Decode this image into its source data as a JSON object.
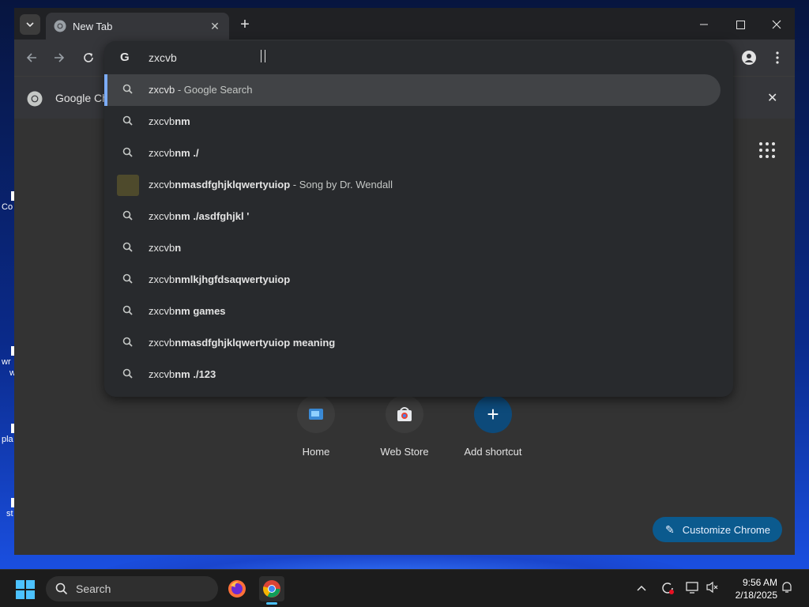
{
  "window": {
    "tab_title": "New Tab",
    "favicon_icon": "chrome-logo-icon"
  },
  "bookmarks_bar": {
    "item_label": "Google Ch"
  },
  "omnibox": {
    "typed_text": "zxcvb",
    "suggestions": [
      {
        "typed": "zxcvb",
        "completion": "",
        "description": " - Google Search",
        "icon": "search-icon",
        "selected": true
      },
      {
        "typed": "zxcvb",
        "completion": "nm",
        "description": "",
        "icon": "search-icon"
      },
      {
        "typed": "zxcvb",
        "completion": "nm ./",
        "description": "",
        "icon": "search-icon"
      },
      {
        "typed": "zxcvb",
        "completion": "nmasdfghjklqwertyuiop",
        "description": " - Song by Dr. Wendall",
        "icon": "album-thumbnail"
      },
      {
        "typed": "zxcvb",
        "completion": "nm ./asdfghjkl '",
        "description": "",
        "icon": "search-icon"
      },
      {
        "typed": "zxcvb",
        "completion": "n",
        "description": "",
        "icon": "search-icon"
      },
      {
        "typed": "zxcvb",
        "completion": "nmlkjhgfdsaqwertyuiop",
        "description": "",
        "icon": "search-icon"
      },
      {
        "typed": "zxcvb",
        "completion": "nm games",
        "description": "",
        "icon": "search-icon"
      },
      {
        "typed": "zxcvb",
        "completion": "nmasdfghjklqwertyuiop meaning",
        "description": "",
        "icon": "search-icon"
      },
      {
        "typed": "zxcvb",
        "completion": "nm ./123",
        "description": "",
        "icon": "search-icon"
      }
    ]
  },
  "shortcuts": [
    {
      "label": "Home"
    },
    {
      "label": "Web Store"
    },
    {
      "label": "Add shortcut"
    }
  ],
  "customize_label": "Customize Chrome",
  "taskbar": {
    "search_placeholder": "Search",
    "time": "9:56 AM",
    "date": "2/18/2025"
  },
  "desktop_icons": [
    {
      "label": "Co"
    },
    {
      "label": "wr"
    },
    {
      "label": "w"
    },
    {
      "label": "pla"
    },
    {
      "label": "st"
    }
  ],
  "colors": {
    "accent_blue": "#7cacf8",
    "customize_bg": "#0b5a8e",
    "windows_blue": "#4cc2ff"
  }
}
